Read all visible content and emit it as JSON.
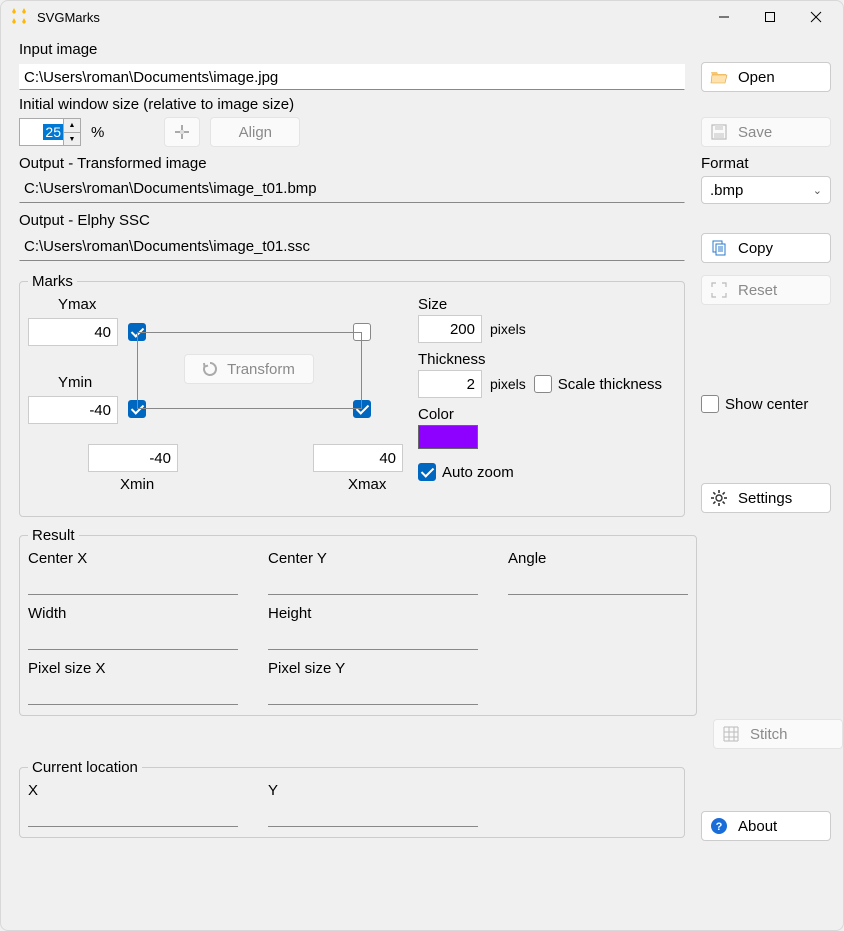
{
  "title": "SVGMarks",
  "input_image": {
    "label": "Input image",
    "value": "C:\\Users\\roman\\Documents\\image.jpg"
  },
  "open_btn": "Open",
  "initial_window": {
    "label": "Initial window size (relative to image size)",
    "value": "25",
    "unit": "%"
  },
  "align_btn": "Align",
  "save_btn": "Save",
  "output_transformed": {
    "label": "Output - Transformed image",
    "value": "C:\\Users\\roman\\Documents\\image_t01.bmp"
  },
  "format": {
    "label": "Format",
    "value": ".bmp"
  },
  "output_ssc": {
    "label": "Output - Elphy SSC",
    "value": "C:\\Users\\roman\\Documents\\image_t01.ssc"
  },
  "copy_btn": "Copy",
  "reset_btn": "Reset",
  "show_center_label": "Show center",
  "settings_btn": "Settings",
  "stitch_btn": "Stitch",
  "about_btn": "About",
  "marks": {
    "legend": "Marks",
    "ymax_label": "Ymax",
    "ymax": "40",
    "ymin_label": "Ymin",
    "ymin": "-40",
    "xmin_label": "Xmin",
    "xmin": "-40",
    "xmax_label": "Xmax",
    "xmax": "40",
    "transform_btn": "Transform",
    "size_label": "Size",
    "size": "200",
    "size_unit": "pixels",
    "thickness_label": "Thickness",
    "thickness": "2",
    "thickness_unit": "pixels",
    "scale_thickness_label": "Scale thickness",
    "color_label": "Color",
    "color": "#8e00ff",
    "auto_zoom_label": "Auto zoom"
  },
  "result": {
    "legend": "Result",
    "center_x_label": "Center X",
    "center_y_label": "Center Y",
    "angle_label": "Angle",
    "width_label": "Width",
    "height_label": "Height",
    "px_x_label": "Pixel size X",
    "px_y_label": "Pixel size Y"
  },
  "current_loc": {
    "legend": "Current location",
    "x_label": "X",
    "y_label": "Y"
  }
}
